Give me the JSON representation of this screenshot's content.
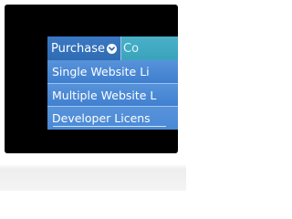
{
  "menu": {
    "purchase_label": "Purchase",
    "next_label": "Co",
    "chevron_icon": "chevron-down-icon",
    "submenu": [
      {
        "label": "Single Website Li"
      },
      {
        "label": "Multiple Website L"
      },
      {
        "label": "Developer Licens"
      }
    ]
  },
  "colors": {
    "background": "#000000",
    "menubar": "#2e6fb8",
    "menubar_next": "#49b0c8",
    "submenu": "#4a86d2",
    "text": "#ffffff"
  }
}
